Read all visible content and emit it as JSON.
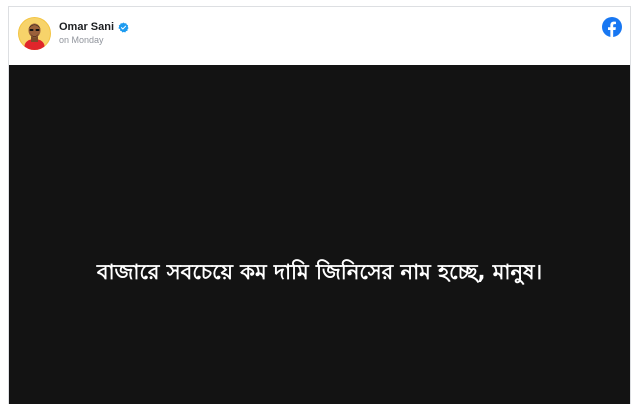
{
  "post": {
    "author": "Omar Sani",
    "timestamp": "on Monday",
    "verified": true,
    "quote_text": "বাজারে সবচেয়ে কম দামি জিনিসের নাম হচ্ছে, মানুষ।"
  },
  "colors": {
    "brand_blue": "#1877f2",
    "verified_blue": "#1d9bf0",
    "media_background": "#131313",
    "quote_text": "#ffffff"
  },
  "icons": {
    "platform": "facebook-logo-icon",
    "verified": "verified-badge-icon"
  }
}
